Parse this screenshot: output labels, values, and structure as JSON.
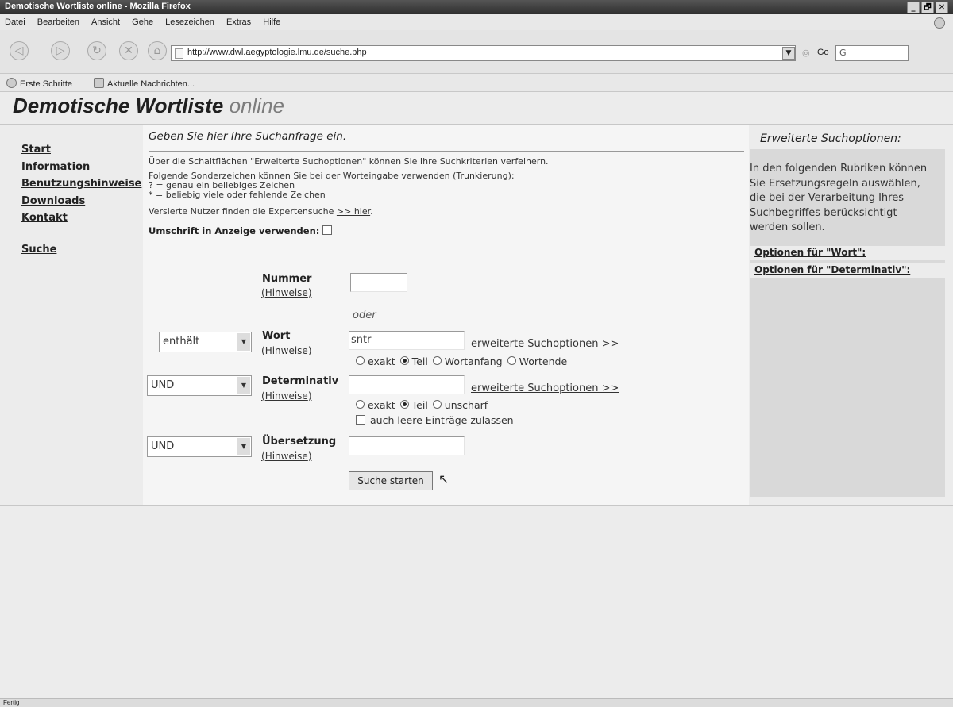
{
  "window": {
    "title": "Demotische Wortliste online - Mozilla Firefox",
    "controls": [
      "_",
      "🗗",
      "✕"
    ]
  },
  "menu": [
    "Datei",
    "Bearbeiten",
    "Ansicht",
    "Gehe",
    "Lesezeichen",
    "Extras",
    "Hilfe"
  ],
  "toolbar": {
    "url": "http://www.dwl.aegyptologie.lmu.de/suche.php",
    "go_label": "Go",
    "search_value": "G"
  },
  "bookmarks": [
    "Erste Schritte",
    "Aktuelle Nachrichten..."
  ],
  "banner": {
    "bold": "Demotische Wortliste",
    "light": "online"
  },
  "nav": [
    "Start",
    "Information",
    "Benutzungshinweise",
    "Downloads",
    "Kontakt",
    "Suche"
  ],
  "main": {
    "title": "Geben Sie hier Ihre Suchanfrage ein.",
    "line1": "Über die Schaltflächen \"Erweiterte Suchoptionen\" können Sie Ihre Suchkriterien verfeinern.",
    "line2": "Folgende Sonderzeichen können Sie bei der Worteingabe verwenden (Trunkierung):",
    "line3": "? = genau ein beliebiges Zeichen",
    "line4": "* = beliebig viele oder fehlende Zeichen",
    "line5_prefix": "Versierte Nutzer finden die Expertensuche ",
    "line5_link": ">> hier",
    "line5_suffix": ".",
    "umschrift": "Umschrift in Anzeige verwenden:"
  },
  "form": {
    "hinweise": "Hinweise",
    "nummer_label": "Nummer",
    "oder": "oder",
    "wort_mode": "enthält",
    "wort_label": "Wort",
    "wort_value": "sntr",
    "wort_ext": "erweiterte Suchoptionen >>",
    "wort_options": [
      "exakt",
      "Teil",
      "Wortanfang",
      "Wortende"
    ],
    "det_op": "UND",
    "det_label": "Determinativ",
    "det_ext": "erweiterte Suchoptionen >>",
    "det_options": [
      "exakt",
      "Teil",
      "unscharf"
    ],
    "det_empty": "auch leere Einträge zulassen",
    "ueb_op": "UND",
    "ueb_label": "Übersetzung",
    "submit": "Suche starten"
  },
  "right": {
    "title": "Erweiterte Suchoptionen:",
    "text": "In den folgenden Rubriken können Sie Ersetzungsregeln auswählen, die bei der Verarbeitung Ihres Suchbegriffes berücksichtigt werden sollen.",
    "opt_wort": "Optionen für \"Wort\":",
    "opt_det": "Optionen für \"Determinativ\":"
  },
  "status": "Fertig"
}
